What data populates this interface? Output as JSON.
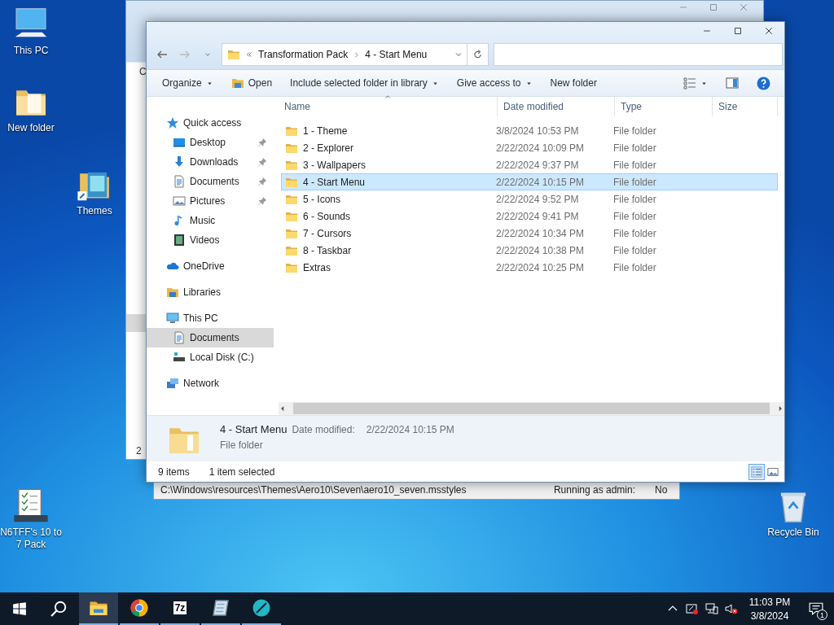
{
  "desktop_icons": [
    {
      "label": "This PC",
      "kind": "pc"
    },
    {
      "label": "New folder",
      "kind": "folder"
    },
    {
      "label": "Themes",
      "kind": "themes"
    },
    {
      "label": "N6TFF's 10 to 7 Pack",
      "kind": "checklist"
    },
    {
      "label": "Recycle Bin",
      "kind": "recycle"
    }
  ],
  "back_window": {
    "toolbar_fragment": "C",
    "status_fragment": "2"
  },
  "dialog": {
    "path": "C:\\Windows\\resources\\Themes\\Aero10\\Seven\\aero10_seven.msstyles",
    "admin_label": "Running as admin:",
    "admin_value": "No"
  },
  "explorer": {
    "address": {
      "segments": [
        "Transformation Pack",
        "4 - Start Menu"
      ]
    },
    "toolbar": [
      {
        "label": "Organize",
        "dropdown": true,
        "icon": false
      },
      {
        "label": "Open",
        "dropdown": false,
        "icon": true
      },
      {
        "label": "Include selected folder in library",
        "dropdown": true,
        "icon": false
      },
      {
        "label": "Give access to",
        "dropdown": true,
        "icon": false
      },
      {
        "label": "New folder",
        "dropdown": false,
        "icon": false
      }
    ],
    "nav": [
      {
        "label": "Quick access",
        "kind": "star",
        "selected": false,
        "pinned": false,
        "children": [
          {
            "label": "Desktop",
            "kind": "desktop",
            "selected": false,
            "pinned": true
          },
          {
            "label": "Downloads",
            "kind": "download",
            "selected": false,
            "pinned": true
          },
          {
            "label": "Documents",
            "kind": "document",
            "selected": false,
            "pinned": true
          },
          {
            "label": "Pictures",
            "kind": "picture",
            "selected": false,
            "pinned": true
          },
          {
            "label": "Music",
            "kind": "music",
            "selected": false,
            "pinned": false
          },
          {
            "label": "Videos",
            "kind": "video",
            "selected": false,
            "pinned": false
          }
        ]
      },
      {
        "label": "OneDrive",
        "kind": "cloud",
        "selected": false,
        "pinned": false
      },
      {
        "label": "Libraries",
        "kind": "library",
        "selected": false,
        "pinned": false
      },
      {
        "label": "This PC",
        "kind": "pc",
        "selected": false,
        "pinned": false,
        "children": [
          {
            "label": "Documents",
            "kind": "document",
            "selected": true,
            "pinned": false
          },
          {
            "label": "Local Disk (C:)",
            "kind": "disk",
            "selected": false,
            "pinned": false
          }
        ]
      },
      {
        "label": "Network",
        "kind": "network",
        "selected": false,
        "pinned": false
      }
    ],
    "columns": [
      {
        "label": "Name",
        "sorted": true
      },
      {
        "label": "Date modified",
        "sorted": false
      },
      {
        "label": "Type",
        "sorted": false
      },
      {
        "label": "Size",
        "sorted": false
      }
    ],
    "rows": [
      {
        "name": "1 - Theme",
        "date": "3/8/2024 10:53 PM",
        "type": "File folder",
        "selected": false
      },
      {
        "name": "2 - Explorer",
        "date": "2/22/2024 10:09 PM",
        "type": "File folder",
        "selected": false
      },
      {
        "name": "3 - Wallpapers",
        "date": "2/22/2024 9:37 PM",
        "type": "File folder",
        "selected": false
      },
      {
        "name": "4 - Start Menu",
        "date": "2/22/2024 10:15 PM",
        "type": "File folder",
        "selected": true
      },
      {
        "name": "5 - Icons",
        "date": "2/22/2024 9:52 PM",
        "type": "File folder",
        "selected": false
      },
      {
        "name": "6 - Sounds",
        "date": "2/22/2024 9:41 PM",
        "type": "File folder",
        "selected": false
      },
      {
        "name": "7 - Cursors",
        "date": "2/22/2024 10:34 PM",
        "type": "File folder",
        "selected": false
      },
      {
        "name": "8 - Taskbar",
        "date": "2/22/2024 10:38 PM",
        "type": "File folder",
        "selected": false
      },
      {
        "name": "Extras",
        "date": "2/22/2024 10:25 PM",
        "type": "File folder",
        "selected": false
      }
    ],
    "details": {
      "name": "4 - Start Menu",
      "date_label": "Date modified:",
      "date": "2/22/2024 10:15 PM",
      "type": "File folder"
    },
    "status": {
      "count": "9 items",
      "selection": "1 item selected"
    },
    "views": [
      {
        "kind": "details",
        "selected": true
      },
      {
        "kind": "tiles",
        "selected": false
      }
    ]
  },
  "taskbar": {
    "apps": [
      {
        "kind": "explorer",
        "active": true
      },
      {
        "kind": "chrome",
        "active": false
      },
      {
        "kind": "sevenzip",
        "label": "7z",
        "active": false
      },
      {
        "kind": "notepad",
        "active": false
      },
      {
        "kind": "teal",
        "active": false
      }
    ],
    "tray_icons": [
      {
        "kind": "chevron"
      },
      {
        "kind": "sync"
      },
      {
        "kind": "network"
      },
      {
        "kind": "volume-muted"
      }
    ],
    "time": "11:03 PM",
    "date": "3/8/2024",
    "notification_count": "1"
  }
}
